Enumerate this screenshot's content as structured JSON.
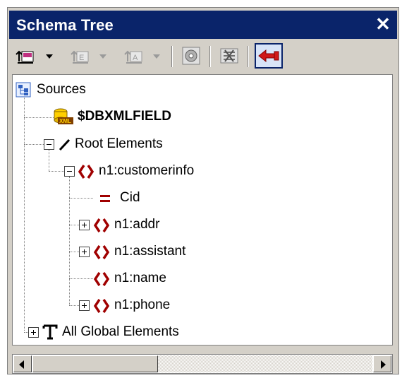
{
  "window": {
    "title": "Schema Tree",
    "close_glyph": "✕"
  },
  "toolbar": {
    "buttons": [
      {
        "icon": "insert-source-icon"
      },
      {
        "icon": "add-element-icon"
      },
      {
        "icon": "add-attribute-icon"
      },
      {
        "icon": "settings-icon"
      },
      {
        "icon": "collapse-icon"
      },
      {
        "icon": "back-arrow-icon"
      }
    ]
  },
  "tree": {
    "sources_label": "Sources",
    "dbxmlfield_label": "$DBXMLFIELD",
    "root_elements_label": "Root Elements",
    "customerinfo_label": "n1:customerinfo",
    "cid_label": "Cid",
    "addr_label": "n1:addr",
    "assistant_label": "n1:assistant",
    "name_label": "n1:name",
    "phone_label": "n1:phone",
    "global_elements_label": "All Global Elements"
  },
  "colors": {
    "title_bar": "#0a246a",
    "element_icon": "#a00000",
    "panel": "#d4d0c8"
  }
}
